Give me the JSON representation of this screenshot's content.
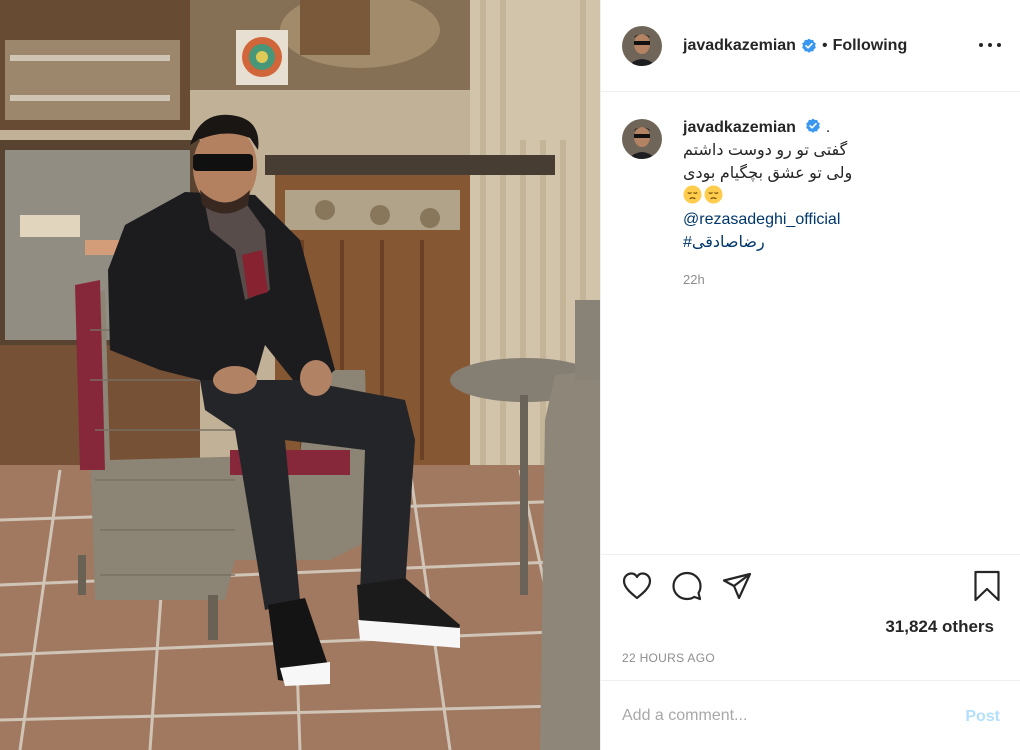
{
  "post": {
    "username": "javadkazemian",
    "dot": "•",
    "follow_status": "Following",
    "more_icon": "more-options-icon"
  },
  "caption": {
    "username": "javadkazemian",
    "suffix": ".",
    "line1": "گفتی تو رو دوست داشتم",
    "line2": "ولی تو عشق بچگیام بودی",
    "emojis": [
      "pensive-face-emoji",
      "pensive-face-emoji"
    ],
    "mention": "@rezasadeghi_official",
    "hashtag": "#رضاصادقی",
    "age": "22h"
  },
  "actions": {
    "icons": [
      "heart-icon",
      "comment-icon",
      "share-icon",
      "bookmark-icon"
    ],
    "likes_text": "31,824 others",
    "timestamp": "22 HOURS AGO"
  },
  "comment": {
    "placeholder": "Add a comment...",
    "post_label": "Post"
  },
  "colors": {
    "link": "#00376b",
    "verified": "#3897f0",
    "post_disabled": "#b2dffc",
    "muted": "#8e8e8e"
  }
}
